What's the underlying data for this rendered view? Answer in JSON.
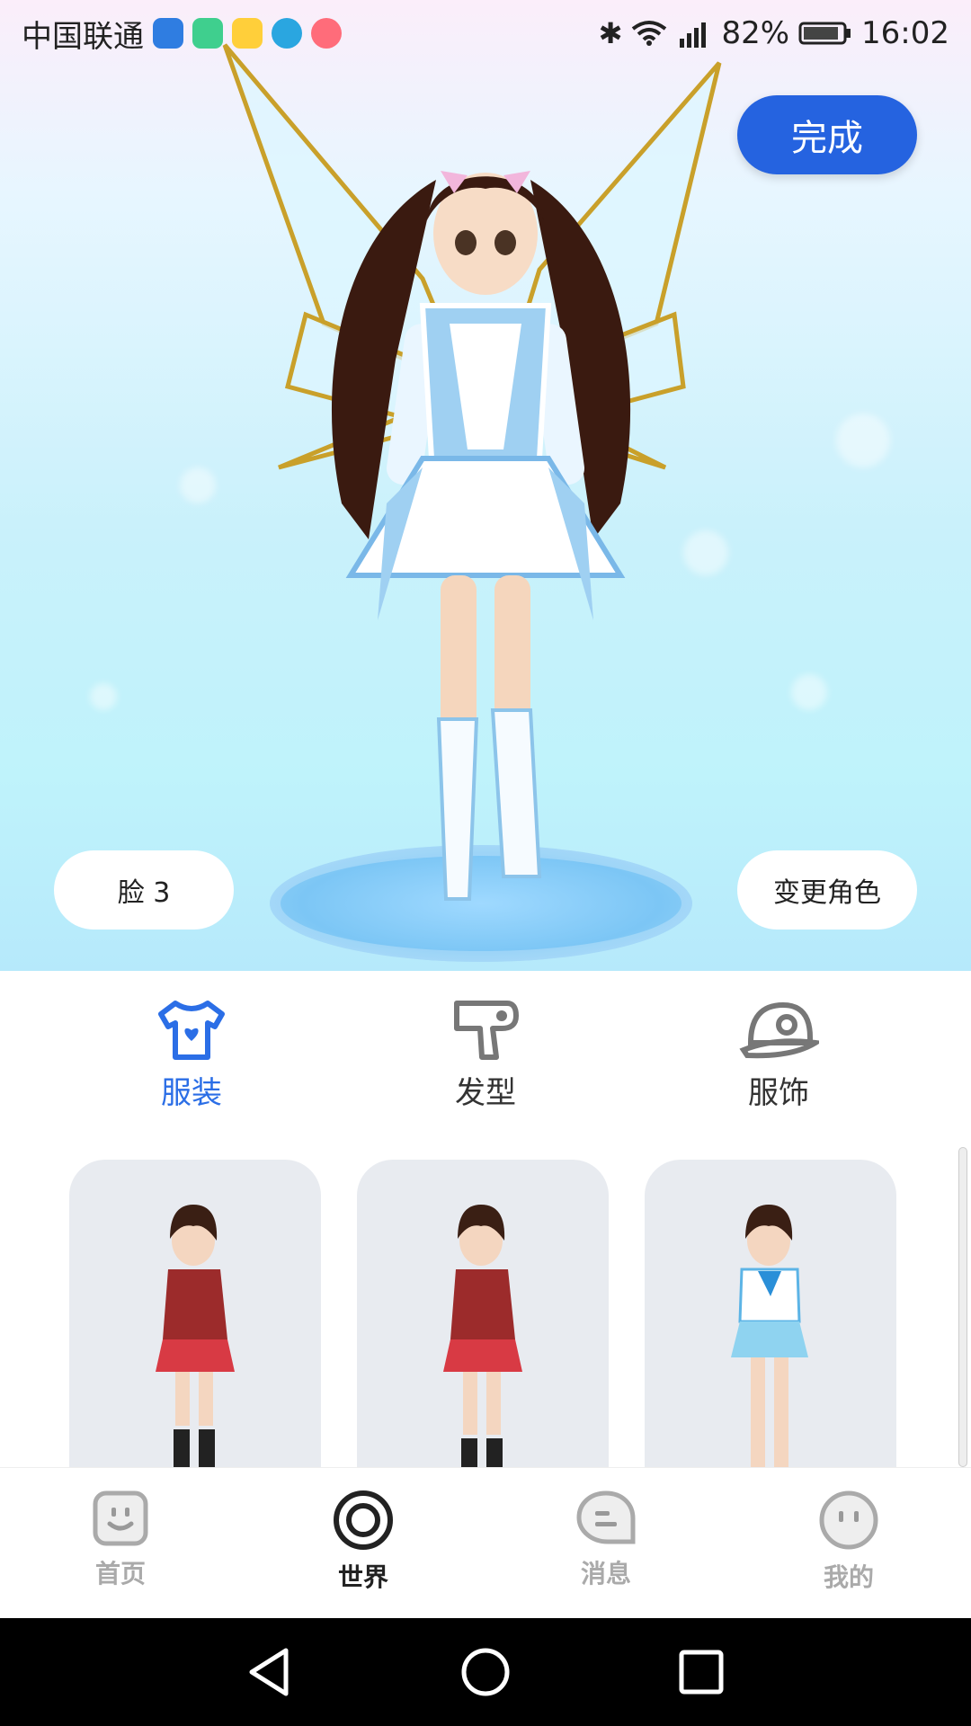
{
  "status_bar": {
    "carrier": "中国联通",
    "battery": "82%",
    "time": "16:02",
    "icons": [
      "shield-app-icon",
      "qu-app-icon",
      "play-app-icon",
      "k-app-icon",
      "flower-app-icon",
      "bluetooth-icon",
      "wifi-icon",
      "signal-icon",
      "battery-icon"
    ]
  },
  "scene": {
    "done_label": "完成",
    "face_label": "脸 3",
    "change_role_label": "变更角色"
  },
  "categories": [
    {
      "label": "服装",
      "icon": "tshirt-icon",
      "active": true
    },
    {
      "label": "发型",
      "icon": "hair-dryer-icon",
      "active": false
    },
    {
      "label": "服饰",
      "icon": "cap-icon",
      "active": false
    }
  ],
  "outfits": [
    {
      "name": "red-blazer-uniform",
      "colors": {
        "top": "#9c2b2b",
        "skirt": "#d83a44"
      }
    },
    {
      "name": "red-blazer-uniform-2",
      "colors": {
        "top": "#9c2b2b",
        "skirt": "#d83a44"
      }
    },
    {
      "name": "sailor-uniform",
      "colors": {
        "top": "#ffffff",
        "skirt": "#8fd3f0"
      }
    }
  ],
  "nav": [
    {
      "label": "首页",
      "icon": "home-face-icon",
      "active": false
    },
    {
      "label": "世界",
      "icon": "world-target-icon",
      "active": true
    },
    {
      "label": "消息",
      "icon": "message-bubble-icon",
      "active": false
    },
    {
      "label": "我的",
      "icon": "profile-face-icon",
      "active": false
    }
  ],
  "colors": {
    "accent": "#2563e0",
    "tab_active": "#2b6ee6"
  }
}
